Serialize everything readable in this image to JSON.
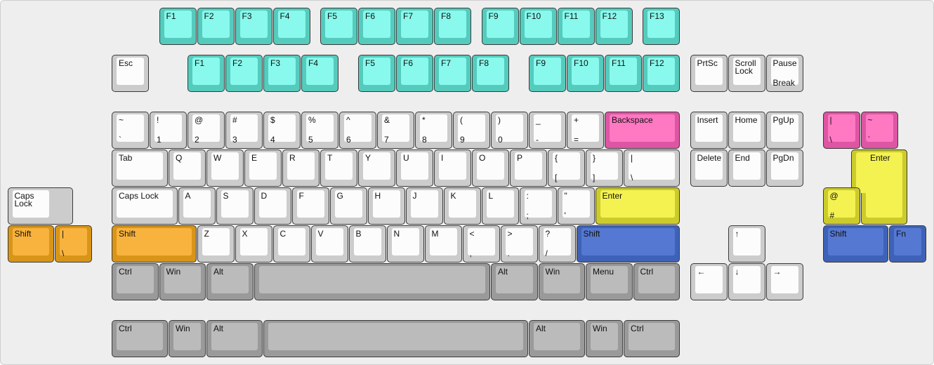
{
  "colors": {
    "alpha": "#fcfcfc",
    "mod": "#bbbbbb",
    "cyan": "#88f9ec",
    "pink": "#ff78c2",
    "yellow": "#f4f251",
    "orange": "#f8b33e",
    "blue": "#5578d2"
  },
  "keys": [
    {
      "t": "F1",
      "c": "cyan"
    },
    {
      "t": "F2",
      "c": "cyan"
    },
    {
      "t": "F3",
      "c": "cyan"
    },
    {
      "t": "F4",
      "c": "cyan"
    },
    {
      "t": "F5",
      "c": "cyan"
    },
    {
      "t": "F6",
      "c": "cyan"
    },
    {
      "t": "F7",
      "c": "cyan"
    },
    {
      "t": "F8",
      "c": "cyan"
    },
    {
      "t": "F9",
      "c": "cyan"
    },
    {
      "t": "F10",
      "c": "cyan"
    },
    {
      "t": "F11",
      "c": "cyan"
    },
    {
      "t": "F12",
      "c": "cyan"
    },
    {
      "t": "F13",
      "c": "cyan"
    },
    {
      "t": "Esc",
      "c": "alpha"
    },
    {
      "t": "F1",
      "c": "cyan"
    },
    {
      "t": "F2",
      "c": "cyan"
    },
    {
      "t": "F3",
      "c": "cyan"
    },
    {
      "t": "F4",
      "c": "cyan"
    },
    {
      "t": "F5",
      "c": "cyan"
    },
    {
      "t": "F6",
      "c": "cyan"
    },
    {
      "t": "F7",
      "c": "cyan"
    },
    {
      "t": "F8",
      "c": "cyan"
    },
    {
      "t": "F9",
      "c": "cyan"
    },
    {
      "t": "F10",
      "c": "cyan"
    },
    {
      "t": "F11",
      "c": "cyan"
    },
    {
      "t": "F12",
      "c": "cyan"
    },
    {
      "t": "PrtSc",
      "c": "alpha"
    },
    {
      "t": "Scroll\nLock",
      "c": "alpha"
    },
    {
      "t": "Pause",
      "b": "Break",
      "c": "alpha"
    },
    {
      "t": "~",
      "b": "`",
      "c": "alpha"
    },
    {
      "t": "!",
      "b": "1",
      "c": "alpha"
    },
    {
      "t": "@",
      "b": "2",
      "c": "alpha"
    },
    {
      "t": "#",
      "b": "3",
      "c": "alpha"
    },
    {
      "t": "$",
      "b": "4",
      "c": "alpha"
    },
    {
      "t": "%",
      "b": "5",
      "c": "alpha"
    },
    {
      "t": "^",
      "b": "6",
      "c": "alpha"
    },
    {
      "t": "&",
      "b": "7",
      "c": "alpha"
    },
    {
      "t": "*",
      "b": "8",
      "c": "alpha"
    },
    {
      "t": "(",
      "b": "9",
      "c": "alpha"
    },
    {
      "t": ")",
      "b": "0",
      "c": "alpha"
    },
    {
      "t": "_",
      "b": "-",
      "c": "alpha"
    },
    {
      "t": "+",
      "b": "=",
      "c": "alpha"
    },
    {
      "t": "Backspace",
      "c": "pink"
    },
    {
      "t": "Insert",
      "c": "alpha"
    },
    {
      "t": "Home",
      "c": "alpha"
    },
    {
      "t": "PgUp",
      "c": "alpha"
    },
    {
      "t": "|",
      "b": "\\",
      "c": "pink"
    },
    {
      "t": "~",
      "b": "`",
      "c": "pink"
    },
    {
      "t": "Tab",
      "c": "alpha"
    },
    {
      "t": "Q",
      "c": "alpha"
    },
    {
      "t": "W",
      "c": "alpha"
    },
    {
      "t": "E",
      "c": "alpha"
    },
    {
      "t": "R",
      "c": "alpha"
    },
    {
      "t": "T",
      "c": "alpha"
    },
    {
      "t": "Y",
      "c": "alpha"
    },
    {
      "t": "U",
      "c": "alpha"
    },
    {
      "t": "I",
      "c": "alpha"
    },
    {
      "t": "O",
      "c": "alpha"
    },
    {
      "t": "P",
      "c": "alpha"
    },
    {
      "t": "{",
      "b": "[",
      "c": "alpha"
    },
    {
      "t": "}",
      "b": "]",
      "c": "alpha"
    },
    {
      "t": "|",
      "b": "\\",
      "c": "alpha"
    },
    {
      "t": "Delete",
      "c": "alpha"
    },
    {
      "t": "End",
      "c": "alpha"
    },
    {
      "t": "PgDn",
      "c": "alpha"
    },
    {
      "t": "Enter",
      "c": "yellow"
    },
    {
      "t": "Caps\nLock",
      "c": "alpha"
    },
    {
      "t": "Caps Lock",
      "c": "alpha"
    },
    {
      "t": "A",
      "c": "alpha"
    },
    {
      "t": "S",
      "c": "alpha"
    },
    {
      "t": "D",
      "c": "alpha"
    },
    {
      "t": "F",
      "c": "alpha"
    },
    {
      "t": "G",
      "c": "alpha"
    },
    {
      "t": "H",
      "c": "alpha"
    },
    {
      "t": "J",
      "c": "alpha"
    },
    {
      "t": "K",
      "c": "alpha"
    },
    {
      "t": "L",
      "c": "alpha"
    },
    {
      "t": ":",
      "b": ";",
      "c": "alpha"
    },
    {
      "t": "\"",
      "b": "'",
      "c": "alpha"
    },
    {
      "t": "Enter",
      "c": "yellow"
    },
    {
      "t": "@",
      "b": "#",
      "c": "yellow"
    },
    {
      "t": "Shift",
      "c": "orange"
    },
    {
      "t": "|",
      "b": "\\",
      "c": "orange"
    },
    {
      "t": "Shift",
      "c": "orange"
    },
    {
      "t": "Z",
      "c": "alpha"
    },
    {
      "t": "X",
      "c": "alpha"
    },
    {
      "t": "C",
      "c": "alpha"
    },
    {
      "t": "V",
      "c": "alpha"
    },
    {
      "t": "B",
      "c": "alpha"
    },
    {
      "t": "N",
      "c": "alpha"
    },
    {
      "t": "M",
      "c": "alpha"
    },
    {
      "t": "<",
      "b": ",",
      "c": "alpha"
    },
    {
      "t": ">",
      "b": ".",
      "c": "alpha"
    },
    {
      "t": "?",
      "b": "/",
      "c": "alpha"
    },
    {
      "t": "Shift",
      "c": "blue"
    },
    {
      "t": "↑",
      "c": "alpha"
    },
    {
      "t": "Shift",
      "c": "blue"
    },
    {
      "t": "Fn",
      "c": "blue"
    },
    {
      "t": "Ctrl",
      "c": "mod"
    },
    {
      "t": "Win",
      "c": "mod"
    },
    {
      "t": "Alt",
      "c": "mod"
    },
    {
      "t": "",
      "c": "mod"
    },
    {
      "t": "Alt",
      "c": "mod"
    },
    {
      "t": "Win",
      "c": "mod"
    },
    {
      "t": "Menu",
      "c": "mod"
    },
    {
      "t": "Ctrl",
      "c": "mod"
    },
    {
      "t": "←",
      "c": "alpha"
    },
    {
      "t": "↓",
      "c": "alpha"
    },
    {
      "t": "→",
      "c": "alpha"
    },
    {
      "t": "Ctrl",
      "c": "mod"
    },
    {
      "t": "Win",
      "c": "mod"
    },
    {
      "t": "Alt",
      "c": "mod"
    },
    {
      "t": "",
      "c": "mod"
    },
    {
      "t": "Alt",
      "c": "mod"
    },
    {
      "t": "Win",
      "c": "mod"
    },
    {
      "t": "Ctrl",
      "c": "mod"
    }
  ]
}
